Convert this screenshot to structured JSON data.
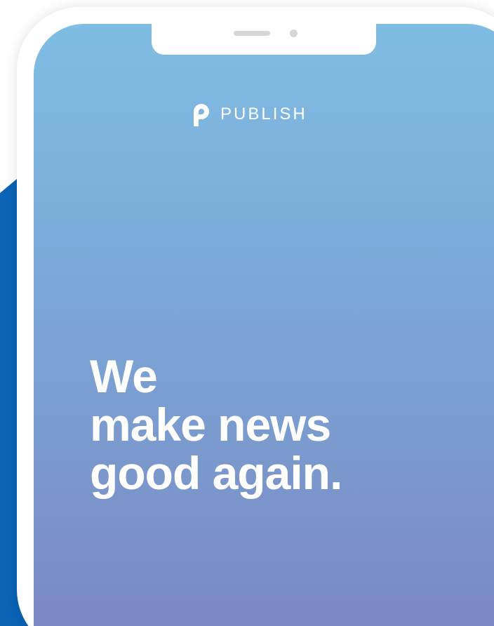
{
  "brand": {
    "logo_icon": "publish-p-logo-icon",
    "name": "PUBLISH"
  },
  "headline": {
    "lines": [
      "We",
      "make news",
      "good again."
    ]
  },
  "colors": {
    "accent_band": "#0a63b5",
    "gradient_top": "#7fbde3",
    "gradient_mid": "#7ba6d6",
    "gradient_bottom": "#7b87c2",
    "text": "#ffffff"
  }
}
